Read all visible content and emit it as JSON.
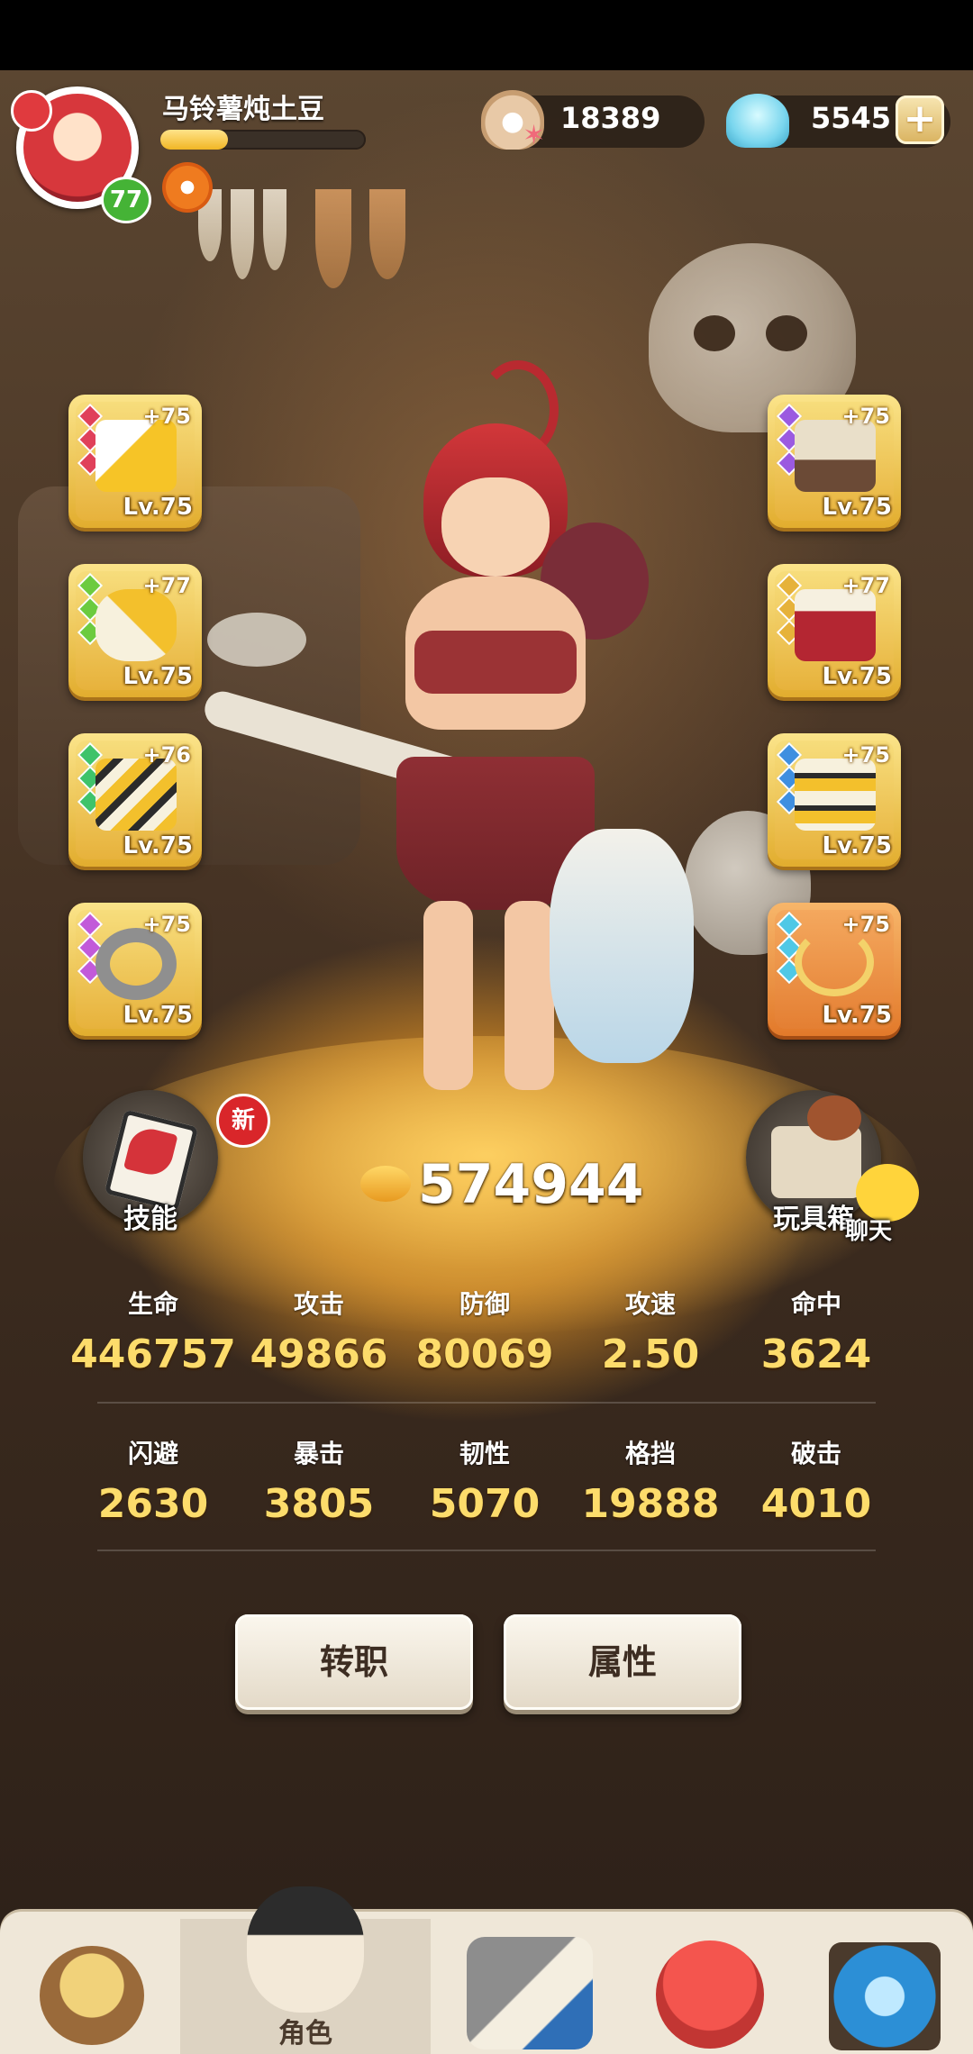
{
  "player": {
    "name": "马铃薯炖土豆",
    "level": "77",
    "xp_fraction": 0.33
  },
  "currency": {
    "pearls": "18389",
    "shells": "5545",
    "add_label": "+"
  },
  "equipment": {
    "left": [
      {
        "plus": "+75",
        "level": "Lv.75",
        "gem_color": "#e0405a",
        "frame": "gold"
      },
      {
        "plus": "+77",
        "level": "Lv.75",
        "gem_color": "#6ccb3f",
        "frame": "gold"
      },
      {
        "plus": "+76",
        "level": "Lv.75",
        "gem_color": "#3fc36a",
        "frame": "gold"
      },
      {
        "plus": "+75",
        "level": "Lv.75",
        "gem_color": "#c25ad9",
        "frame": "gold"
      }
    ],
    "right": [
      {
        "plus": "+75",
        "level": "Lv.75",
        "gem_color": "#9b5ae0",
        "frame": "gold"
      },
      {
        "plus": "+77",
        "level": "Lv.75",
        "gem_color": "#e6b23a",
        "frame": "gold"
      },
      {
        "plus": "+75",
        "level": "Lv.75",
        "gem_color": "#3f8fe0",
        "frame": "gold"
      },
      {
        "plus": "+75",
        "level": "Lv.75",
        "gem_color": "#4fc8e6",
        "frame": "orange"
      }
    ]
  },
  "side_buttons": {
    "skill_label": "技能",
    "new_badge": "新",
    "toybox_label": "玩具箱",
    "chat_label": "聊天"
  },
  "power": "574944",
  "stats": {
    "row1": [
      {
        "label": "生命",
        "value": "446757"
      },
      {
        "label": "攻击",
        "value": "49866"
      },
      {
        "label": "防御",
        "value": "80069"
      },
      {
        "label": "攻速",
        "value": "2.50"
      },
      {
        "label": "命中",
        "value": "3624"
      }
    ],
    "row2": [
      {
        "label": "闪避",
        "value": "2630"
      },
      {
        "label": "暴击",
        "value": "3805"
      },
      {
        "label": "韧性",
        "value": "5070"
      },
      {
        "label": "格挡",
        "value": "19888"
      },
      {
        "label": "破击",
        "value": "4010"
      }
    ]
  },
  "actions": {
    "transfer_label": "转职",
    "attributes_label": "属性"
  },
  "nav": {
    "active_label": "角色"
  },
  "colors": {
    "accent_gold": "#fddc6b",
    "level_green": "#45b336",
    "new_red": "#d9262a"
  }
}
